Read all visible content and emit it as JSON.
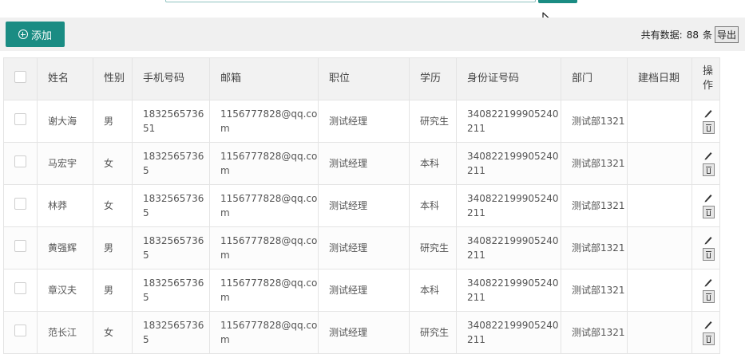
{
  "toolbar": {
    "add_label": "添加",
    "total_label": "共有数据:",
    "total_count": "88",
    "total_unit": "条",
    "export_label": "导出"
  },
  "table": {
    "headers": [
      "姓名",
      "性别",
      "手机号码",
      "邮箱",
      "职位",
      "学历",
      "身份证号码",
      "部门",
      "建档日期",
      "操作"
    ],
    "rows": [
      {
        "name": "谢大海",
        "gender": "男",
        "phone": "183256573651",
        "email": "1156777828@qq.com",
        "position": "测试经理",
        "education": "研究生",
        "id_card": "340822199905240211",
        "department": "测试部1321",
        "date": ""
      },
      {
        "name": "马宏宇",
        "gender": "女",
        "phone": "18325657365",
        "email": "1156777828@qq.com",
        "position": "测试经理",
        "education": "本科",
        "id_card": "340822199905240211",
        "department": "测试部1321",
        "date": ""
      },
      {
        "name": "林莽",
        "gender": "女",
        "phone": "18325657365",
        "email": "1156777828@qq.com",
        "position": "测试经理",
        "education": "本科",
        "id_card": "340822199905240211",
        "department": "测试部1321",
        "date": ""
      },
      {
        "name": "黄强辉",
        "gender": "男",
        "phone": "18325657365",
        "email": "1156777828@qq.com",
        "position": "测试经理",
        "education": "研究生",
        "id_card": "340822199905240211",
        "department": "测试部1321",
        "date": ""
      },
      {
        "name": "章汉夫",
        "gender": "男",
        "phone": "18325657365",
        "email": "1156777828@qq.com",
        "position": "测试经理",
        "education": "本科",
        "id_card": "340822199905240211",
        "department": "测试部1321",
        "date": ""
      },
      {
        "name": "范长江",
        "gender": "女",
        "phone": "18325657365",
        "email": "1156777828@qq.com",
        "position": "测试经理",
        "education": "研究生",
        "id_card": "340822199905240211",
        "department": "测试部1321",
        "date": ""
      }
    ]
  },
  "icons": {
    "add": "plus-circle-icon",
    "edit": "pencil-icon",
    "delete": "trash-icon",
    "cursor": "mouse-pointer-icon"
  },
  "colors": {
    "accent": "#1a8c83",
    "header_bg": "#f2f2f2",
    "toolbar_bg": "#f0f0f0"
  }
}
